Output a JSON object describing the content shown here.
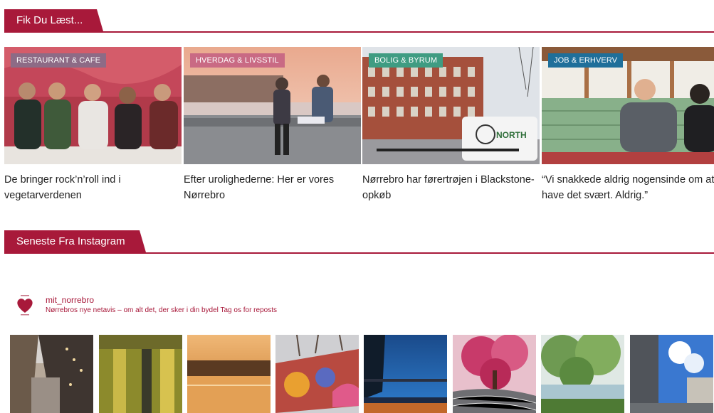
{
  "sections": {
    "read": "Fik Du Læst...",
    "instagram": "Seneste Fra Instagram"
  },
  "articles": [
    {
      "category": "RESTAURANT & CAFE",
      "badge_color": "#8d6b86",
      "title": "De bringer rock’n’roll ind i vegetarverdenen"
    },
    {
      "category": "HVERDAG & LIVSSTIL",
      "badge_color": "#c96a84",
      "title": "Efter urolighederne: Her er vores Nørrebro"
    },
    {
      "category": "BOLIG & BYRUM",
      "badge_color": "#3f9c82",
      "title": "Nørrebro har førertrøjen i Blackstone-opkøb"
    },
    {
      "category": "JOB & ERHVERV",
      "badge_color": "#1f6f9a",
      "title": "“Vi snakkede aldrig nogensinde om at have det svært. Aldrig.”"
    }
  ],
  "instagram": {
    "username": "mit_norrebro",
    "bio": "Nørrebros nye netavis – om alt det, der sker i din bydel Tag os for reposts",
    "avatar_icon": "heart-icon",
    "tile_count": 8
  },
  "colors": {
    "accent": "#a8193a"
  }
}
